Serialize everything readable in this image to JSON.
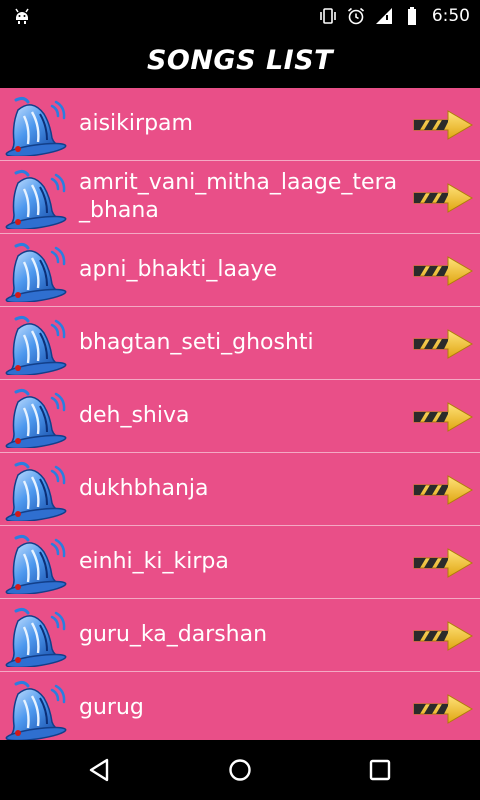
{
  "status_bar": {
    "time": "6:50",
    "icons": [
      "android-debug-icon",
      "vibrate-icon",
      "alarm-icon",
      "signal-icon",
      "battery-icon"
    ]
  },
  "header": {
    "title": "SONGS LIST"
  },
  "songs": [
    {
      "name": "aisikirpam"
    },
    {
      "name": "amrit_vani_mitha_laage_tera_bhana"
    },
    {
      "name": "apni_bhakti_laaye"
    },
    {
      "name": "bhagtan_seti_ghoshti"
    },
    {
      "name": "deh_shiva"
    },
    {
      "name": "dukhbhanja"
    },
    {
      "name": "einhi_ki_kirpa"
    },
    {
      "name": "guru_ka_darshan"
    },
    {
      "name": "gurug"
    }
  ],
  "row_icons": {
    "leading": "bell-icon",
    "trailing": "arrow-right-icon"
  },
  "nav_bar": {
    "buttons": [
      "back-icon",
      "home-icon",
      "recents-icon"
    ]
  },
  "colors": {
    "list_background": "#e94f88",
    "divider": "#f4a9c4",
    "text": "#ffffff",
    "bars": "#000000",
    "bell": "#1e6fd6",
    "arrow": "#f2c230"
  }
}
